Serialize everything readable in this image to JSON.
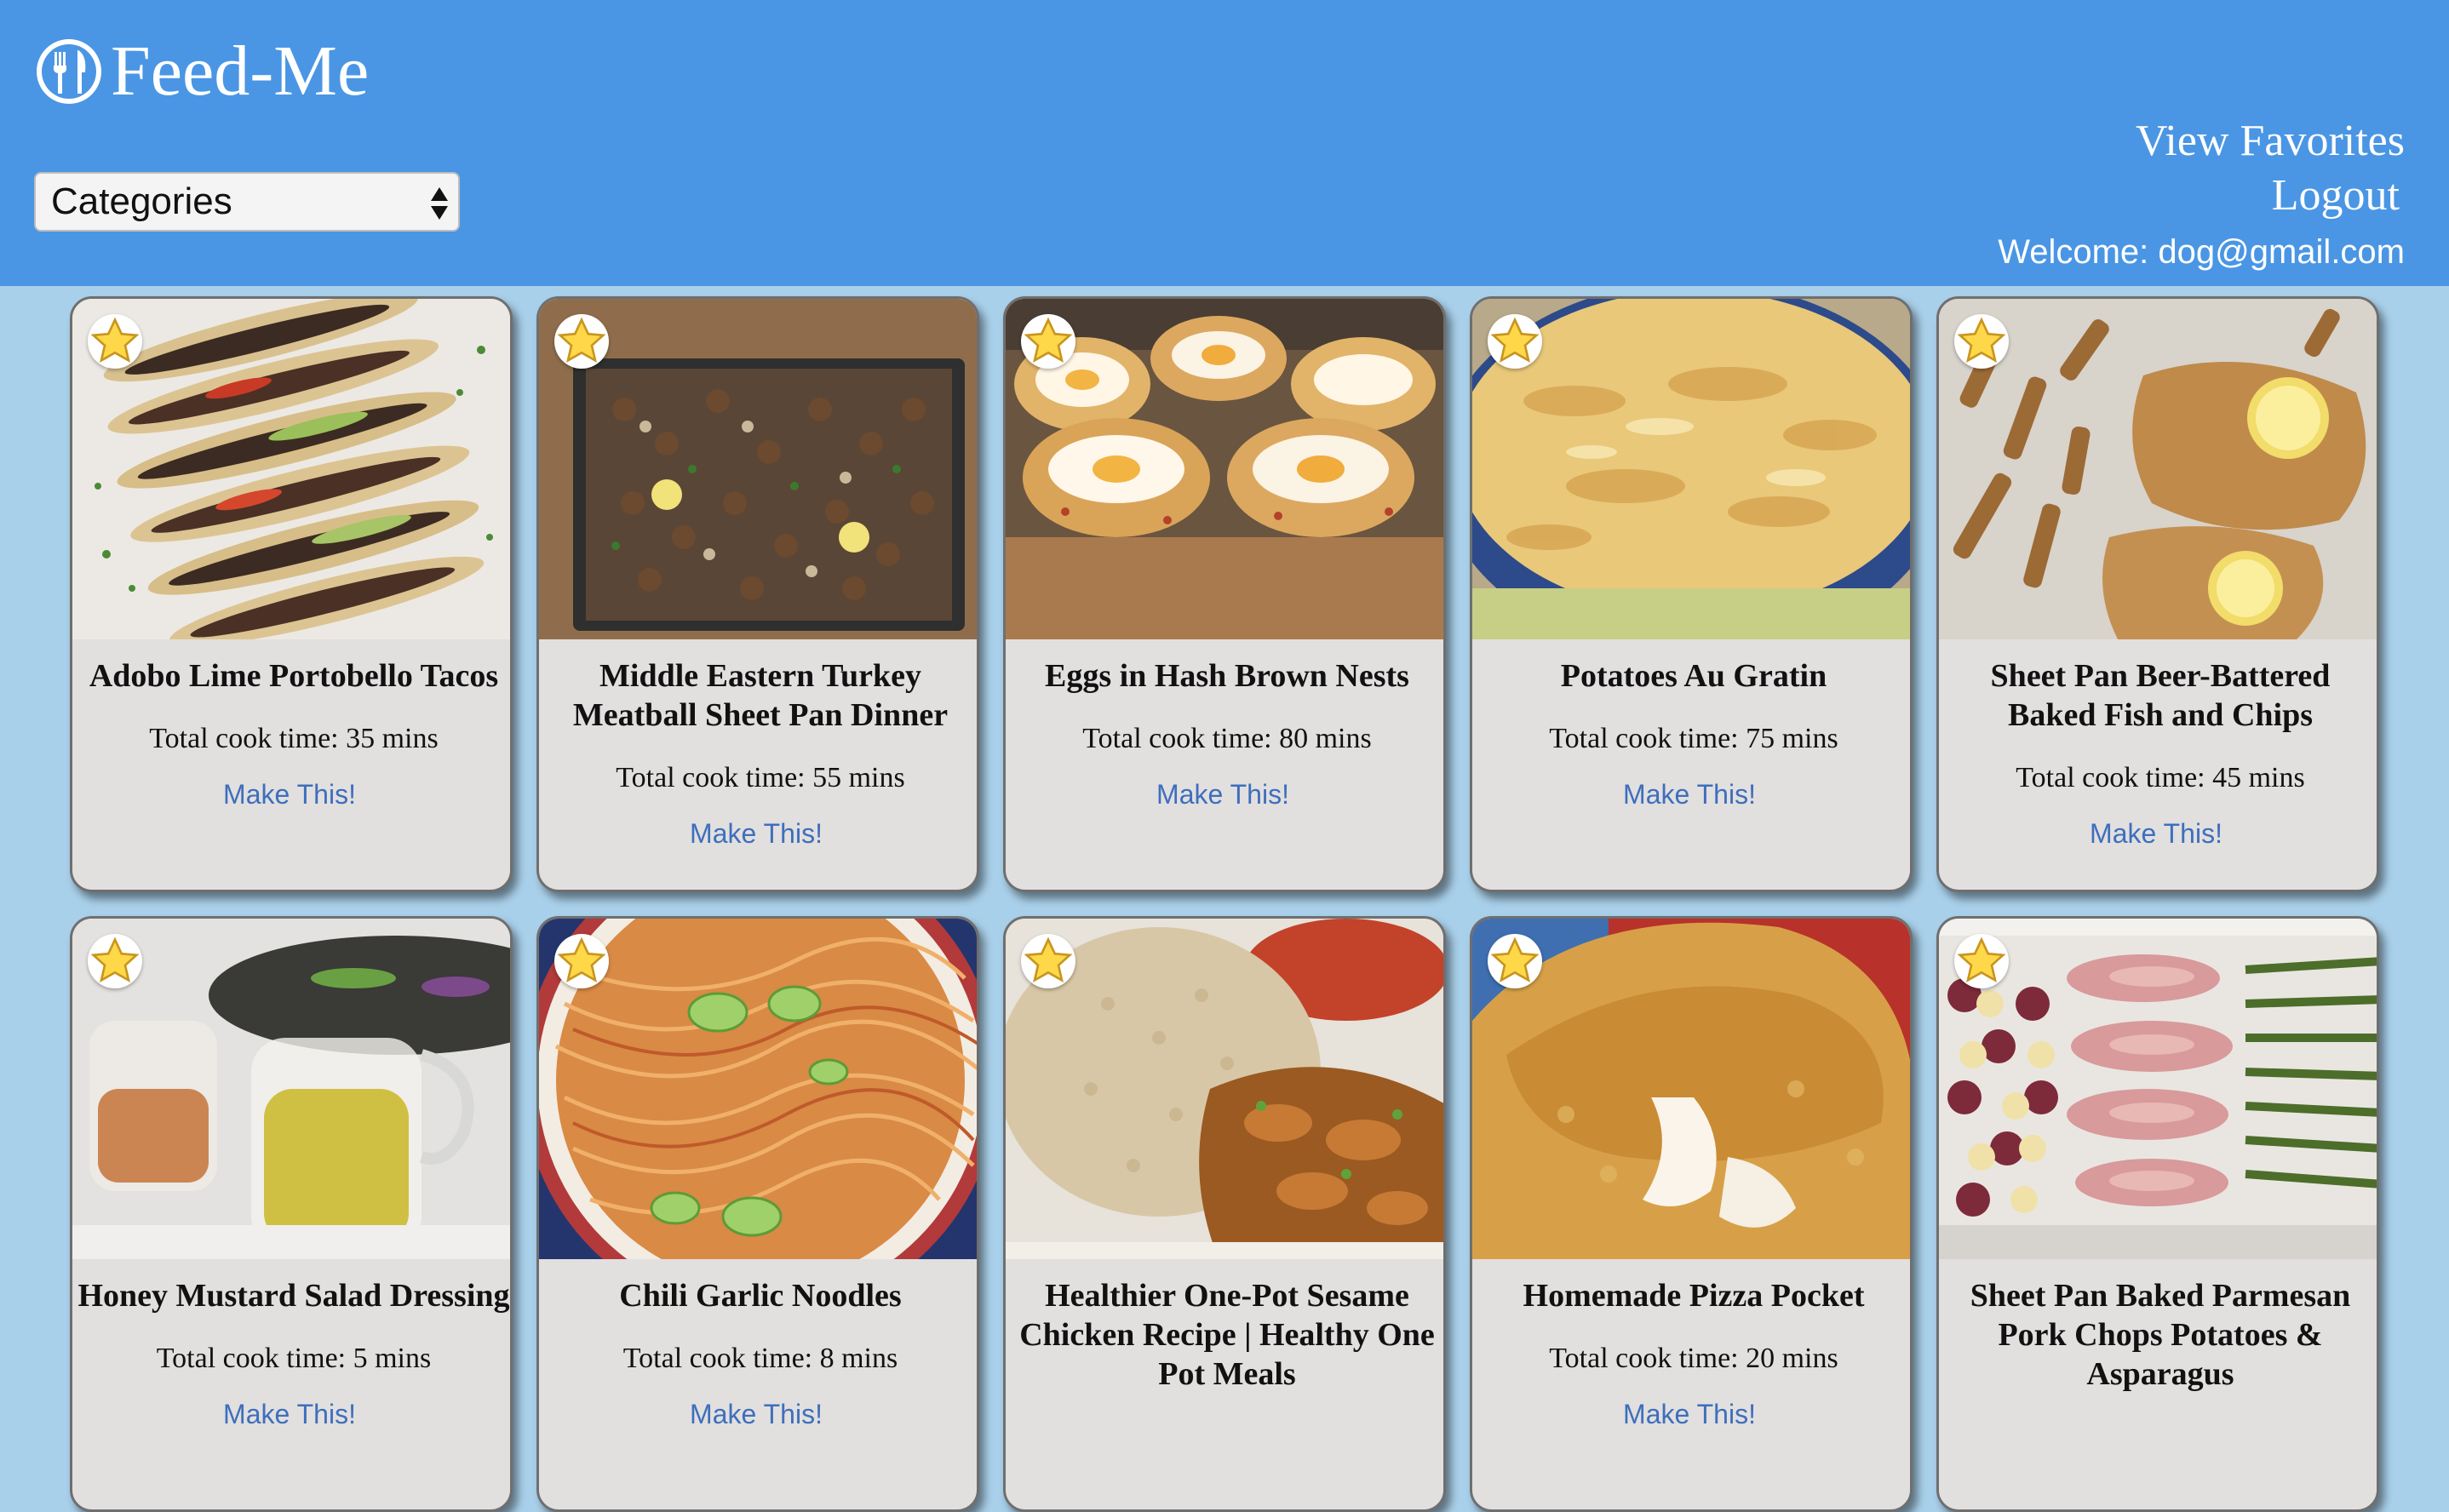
{
  "app": {
    "title": "Feed-Me"
  },
  "header": {
    "categories_label": "Categories",
    "view_favorites": "View Favorites",
    "logout": "Logout",
    "welcome": "Welcome: dog@gmail.com"
  },
  "recipes": [
    {
      "title": "Adobo Lime Portobello Tacos",
      "time": "Total cook time: 35 mins",
      "action": "Make This!"
    },
    {
      "title": "Middle Eastern Turkey Meatball Sheet Pan Dinner",
      "time": "Total cook time: 55 mins",
      "action": "Make This!"
    },
    {
      "title": "Eggs in Hash Brown Nests",
      "time": "Total cook time: 80 mins",
      "action": "Make This!"
    },
    {
      "title": "Potatoes Au Gratin",
      "time": "Total cook time: 75 mins",
      "action": "Make This!"
    },
    {
      "title": "Sheet Pan Beer-Battered Baked Fish and Chips",
      "time": "Total cook time: 45 mins",
      "action": "Make This!"
    },
    {
      "title": "Honey Mustard Salad Dressing",
      "time": "Total cook time: 5 mins",
      "action": "Make This!"
    },
    {
      "title": "Chili Garlic Noodles",
      "time": "Total cook time: 8 mins",
      "action": "Make This!"
    },
    {
      "title": "Healthier One-Pot Sesame Chicken Recipe | Healthy One Pot Meals",
      "time": "",
      "action": ""
    },
    {
      "title": "Homemade Pizza Pocket",
      "time": "Total cook time: 20 mins",
      "action": "Make This!"
    },
    {
      "title": "Sheet Pan Baked Parmesan Pork Chops Potatoes & Asparagus",
      "time": "",
      "action": ""
    }
  ],
  "colors": {
    "header": "#4a96e4",
    "page_bg": "#a9d0ea",
    "card_bg": "#e2dfdf",
    "link": "#3d6fbc"
  }
}
